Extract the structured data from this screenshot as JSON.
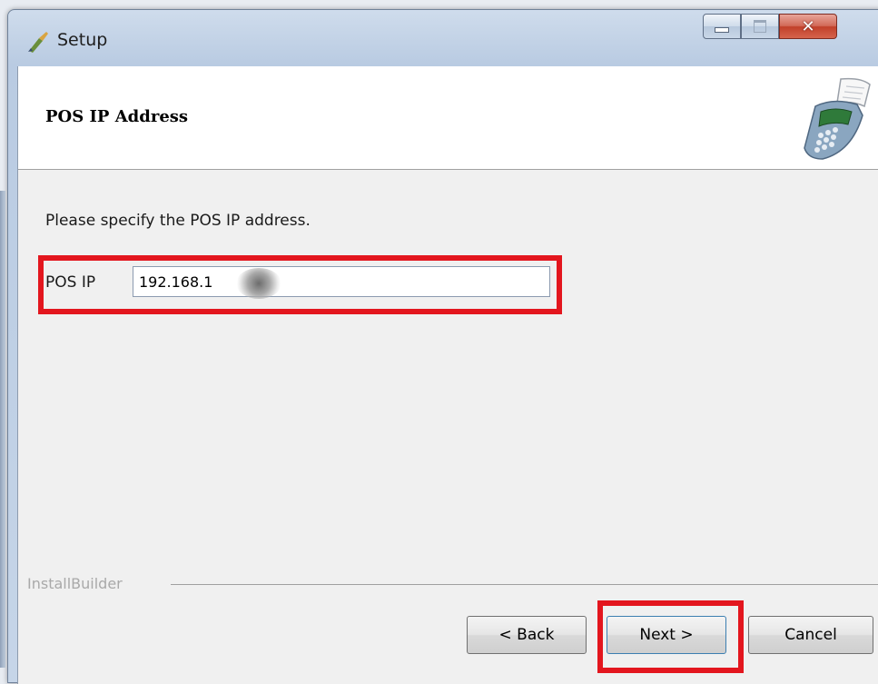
{
  "window": {
    "title": "Setup"
  },
  "header": {
    "title": "POS IP Address",
    "icon": "pos-terminal-icon"
  },
  "main": {
    "instructions": "Please specify  the  POS IP address.",
    "pos_ip": {
      "label": "POS IP",
      "value": "192.168.1"
    }
  },
  "footer": {
    "group_caption": "InstallBuilder",
    "back_label": "< Back",
    "next_label": "Next >",
    "cancel_label": "Cancel"
  },
  "colors": {
    "highlight": "#e3161e",
    "close_button": "#c1402a",
    "titlebar": "#b9cbe2"
  }
}
